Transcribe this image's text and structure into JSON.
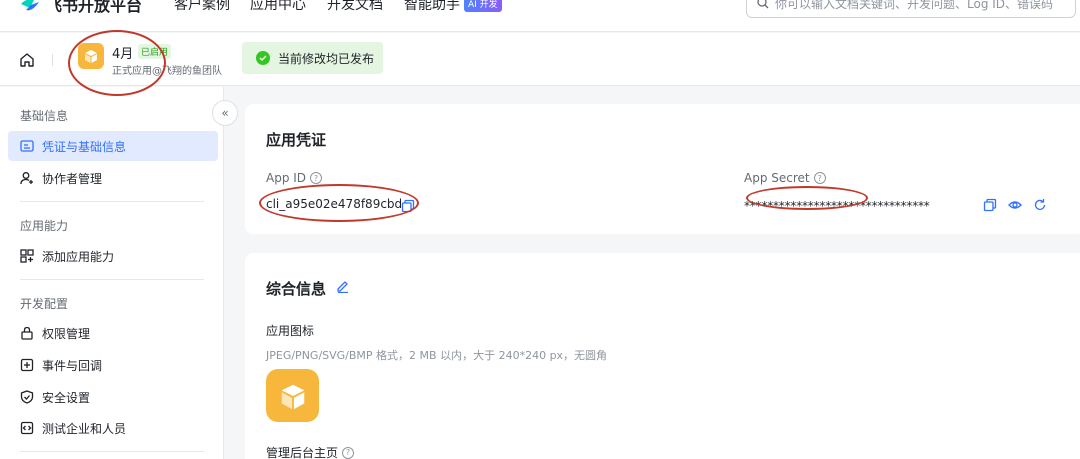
{
  "topnav": {
    "brand": "飞书开放平台",
    "items": [
      {
        "label": "客户案例"
      },
      {
        "label": "应用中心"
      },
      {
        "label": "开发文档"
      },
      {
        "label": "智能助手"
      }
    ],
    "ai_badge": "AI 开发",
    "search_placeholder": "你可以输入文档关键词、开发问题、Log ID、错误码"
  },
  "appbar": {
    "app_name": "4月",
    "app_status": "已启用",
    "app_sub": "正式应用@飞翔的鱼团队",
    "publish_text": "当前修改均已发布"
  },
  "sidebar": {
    "sections": [
      {
        "title": "基础信息",
        "items": [
          {
            "label": "凭证与基础信息",
            "icon": "credential-icon",
            "active": true
          },
          {
            "label": "协作者管理",
            "icon": "user-add-icon"
          }
        ]
      },
      {
        "title": "应用能力",
        "items": [
          {
            "label": "添加应用能力",
            "icon": "add-capability-icon"
          }
        ]
      },
      {
        "title": "开发配置",
        "items": [
          {
            "label": "权限管理",
            "icon": "lock-icon"
          },
          {
            "label": "事件与回调",
            "icon": "event-icon"
          },
          {
            "label": "安全设置",
            "icon": "shield-icon"
          },
          {
            "label": "测试企业和人员",
            "icon": "code-icon"
          }
        ]
      }
    ],
    "collapse_glyph": "«"
  },
  "credentials": {
    "title": "应用凭证",
    "app_id_label": "App ID",
    "app_id_value": "cli_a95e02e478f89cbd",
    "app_secret_label": "App Secret",
    "app_secret_value": "********************************"
  },
  "general": {
    "title": "综合信息",
    "icon_label": "应用图标",
    "icon_hint": "JPEG/PNG/SVG/BMP 格式，2 MB 以内，大于 240*240 px，无圆角",
    "admin_home_label": "管理后台主页"
  },
  "colors": {
    "accent": "#3370ff",
    "annotation": "#c0392b",
    "app_icon": "#f6b73c"
  }
}
